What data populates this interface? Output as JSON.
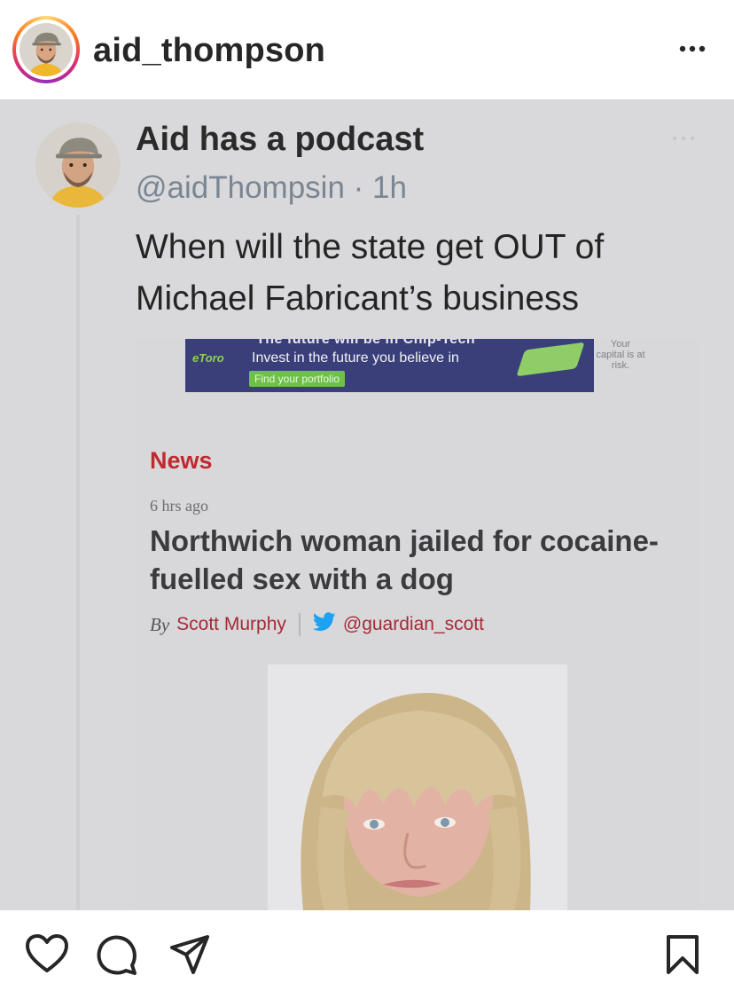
{
  "header": {
    "username": "aid_thompson",
    "avatar_icon": "profile-avatar",
    "more_icon": "more-horizontal-icon"
  },
  "tweet": {
    "display_name": "Aid has a podcast",
    "handle_time": "@aidThompsin · 1h",
    "text": "When will the state get OUT of Michael Fabricant’s business",
    "more_icon": "more-horizontal-icon"
  },
  "ad": {
    "top_text": "The future will be in Chip-Tech",
    "logo": "eToro",
    "tagline": "Invest in the future you believe in",
    "button": "Find your portfolio",
    "risk_note": "Your capital is at risk."
  },
  "article": {
    "section": "News",
    "time": "6 hrs ago",
    "headline": "Northwich woman jailed for cocaine-fuelled sex with a dog",
    "by_label": "By",
    "author": "Scott Murphy",
    "twitter_handle": "@guardian_scott"
  },
  "actions": {
    "like_icon": "heart-icon",
    "comment_icon": "comment-icon",
    "share_icon": "send-icon",
    "save_icon": "bookmark-icon"
  },
  "colors": {
    "instagram_ring": "#d62976",
    "news_red": "#c1292e",
    "handle_grey": "#7a8693",
    "twitter_blue": "#1da1f2",
    "ad_background": "#3a3f7a"
  }
}
